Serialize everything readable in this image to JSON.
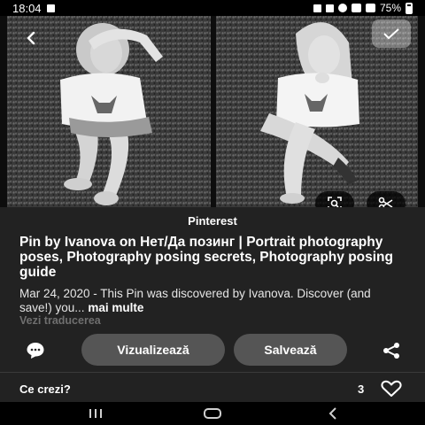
{
  "status_bar": {
    "time": "18:04",
    "battery": "75%"
  },
  "image": {
    "back_icon": "chevron-left-icon",
    "select_icon": "check-icon",
    "lens_icon": "visual-search-icon",
    "scissors_icon": "scissors-icon"
  },
  "pin": {
    "source": "Pinterest",
    "title": "Pin by Ivanova on Нет/Да позинг | Portrait photography poses, Photography posing secrets, Photography posing guide",
    "description": "Mar 24, 2020 - This Pin was discovered by Ivanova. Discover (and save!) you...",
    "more_label": "mai multe",
    "translate_label": "Vezi traducerea"
  },
  "actions": {
    "comment_icon": "comment-bubble-icon",
    "view_label": "Vizualizează",
    "save_label": "Salvează",
    "share_icon": "share-icon"
  },
  "feedback": {
    "prompt": "Ce crezi?",
    "like_count": "3",
    "heart_icon": "heart-icon"
  },
  "nav": {
    "recents_icon": "recents-icon",
    "home_icon": "home-icon",
    "back_icon": "back-icon"
  },
  "colors": {
    "panel_bg": "#222222",
    "button_bg": "#555555",
    "muted_text": "#6f6f6f"
  }
}
